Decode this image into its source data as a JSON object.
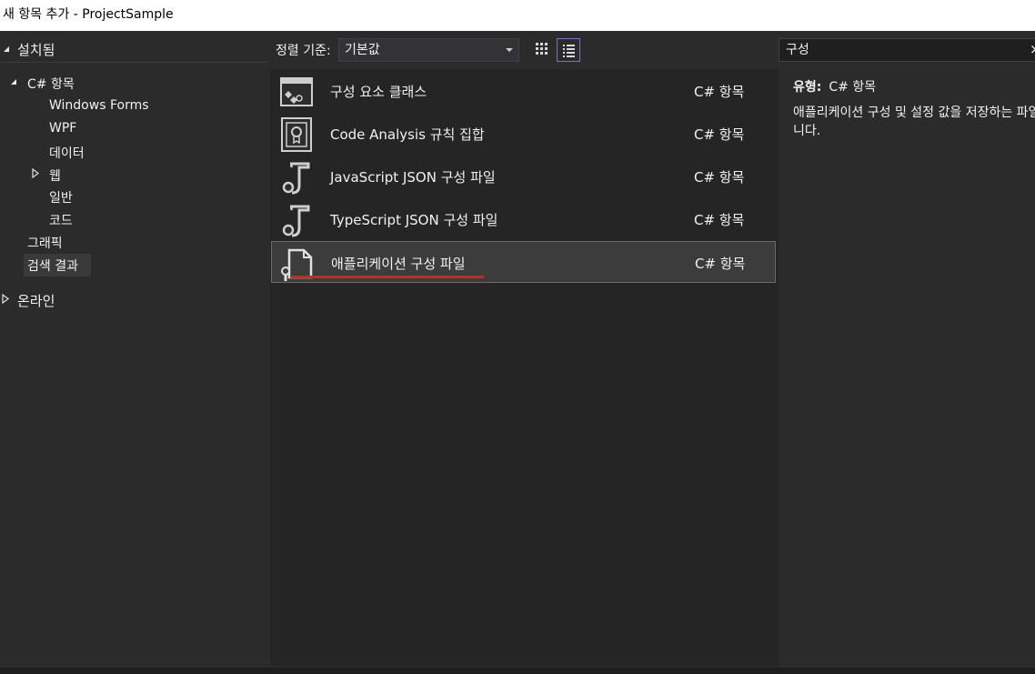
{
  "window": {
    "title": "새 항목 추가 - ProjectSample"
  },
  "left": {
    "installed": "설치됨",
    "tree": {
      "csharp": "C# 항목",
      "windows_forms": "Windows Forms",
      "wpf": "WPF",
      "data": "데이터",
      "web": "웹",
      "general": "일반",
      "code": "코드",
      "graphics": "그래픽",
      "search_results": "검색 결과"
    },
    "online": "온라인"
  },
  "toolbar": {
    "sort_label": "정렬 기준:",
    "sort_value": "기본값"
  },
  "items": [
    {
      "name": "구성 요소 클래스",
      "category": "C# 항목",
      "icon": "component-class-icon"
    },
    {
      "name": "Code Analysis 규칙 집합",
      "category": "C# 항목",
      "icon": "ruleset-icon"
    },
    {
      "name": "JavaScript JSON 구성 파일",
      "category": "C# 항목",
      "icon": "json-config-icon"
    },
    {
      "name": "TypeScript JSON 구성 파일",
      "category": "C# 항목",
      "icon": "json-config-icon"
    },
    {
      "name": "애플리케이션 구성 파일",
      "category": "C# 항목",
      "icon": "app-config-icon"
    }
  ],
  "search": {
    "value": "구성",
    "clear": "×"
  },
  "details": {
    "type_label": "유형:",
    "type_value": "C# 항목",
    "description": "애플리케이션 구성 및 설정 값을 저장하는 파일입니다."
  },
  "colors": {
    "selection_underline": "#e31b23",
    "active_view_border": "#7b6fd6"
  }
}
